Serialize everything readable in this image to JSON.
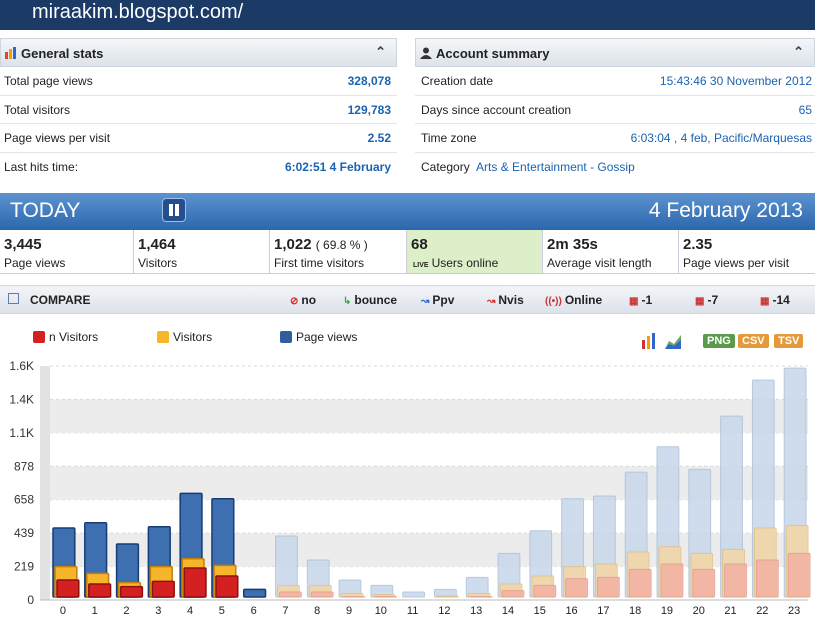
{
  "site": {
    "title": "miraakim.blogspot.com/"
  },
  "general_stats": {
    "title": "General stats",
    "rows": [
      {
        "label": "Total page views",
        "value": "328,078"
      },
      {
        "label": "Total visitors",
        "value": "129,783"
      },
      {
        "label": "Page views per visit",
        "value": "2.52"
      },
      {
        "label": "Last hits time:",
        "value": "6:02:51 4 February"
      }
    ]
  },
  "account_summary": {
    "title": "Account summary",
    "rows": [
      {
        "label": "Creation date",
        "value": "15:43:46 30 November 2012"
      },
      {
        "label": "Days since account creation",
        "value": "65"
      },
      {
        "label": "Time zone",
        "value": "6:03:04 , 4 feb, Pacific/Marquesas"
      }
    ],
    "category_label": "Category",
    "category_value": "Arts & Entertainment - Gossip"
  },
  "today": {
    "label": "TODAY",
    "date": "4 February 2013"
  },
  "metrics": [
    {
      "value": "3,445",
      "label": "Page views"
    },
    {
      "value": "1,464",
      "label": "Visitors"
    },
    {
      "value": "1,022",
      "extra": "( 69.8 % )",
      "label": "First time visitors"
    },
    {
      "value": "68",
      "label": "Users online",
      "live_badge": "LIVE"
    },
    {
      "value": "2m 35s",
      "label": "Average visit length"
    },
    {
      "value": "2.35",
      "label": "Page views per visit"
    }
  ],
  "compare": {
    "label": "COMPARE",
    "buttons": [
      "no",
      "bounce",
      "Ppv",
      "Nvis",
      "Online",
      "-1",
      "-7",
      "-14"
    ]
  },
  "export": [
    "PNG",
    "CSV",
    "TSV"
  ],
  "colors": {
    "new_visitors": "#d42020",
    "visitors": "#f7b52c",
    "page_views": "#2e5e9e",
    "topbar": "#1b3a66",
    "link": "#1a63b2"
  },
  "chart_data": {
    "type": "bar",
    "legend": [
      "n Visitors",
      "Visitors",
      "Page views"
    ],
    "categories": [
      "0",
      "1",
      "2",
      "3",
      "4",
      "5",
      "6",
      "7",
      "8",
      "9",
      "10",
      "11",
      "12",
      "13",
      "14",
      "15",
      "16",
      "17",
      "18",
      "19",
      "20",
      "21",
      "22",
      "23"
    ],
    "y_ticks": [
      "0",
      "219",
      "439",
      "658",
      "878",
      "1.1K",
      "1.4K",
      "1.6K"
    ],
    "ylim": [
      0,
      1756
    ],
    "current_hour_index": 6,
    "series": [
      {
        "name": "n Visitors",
        "values": [
          150,
          120,
          100,
          140,
          240,
          180,
          10,
          60,
          60,
          25,
          25,
          15,
          15,
          25,
          70,
          110,
          160,
          170,
          230,
          270,
          230,
          270,
          300,
          350
        ]
      },
      {
        "name": "Visitors",
        "values": [
          250,
          200,
          130,
          250,
          310,
          260,
          20,
          110,
          110,
          50,
          40,
          20,
          30,
          50,
          120,
          180,
          250,
          270,
          360,
          400,
          350,
          380,
          540,
          560
        ]
      },
      {
        "name": "Page views",
        "values": [
          540,
          580,
          420,
          550,
          800,
          760,
          80,
          480,
          300,
          150,
          110,
          60,
          80,
          170,
          350,
          520,
          760,
          780,
          960,
          1150,
          980,
          1380,
          1650,
          1740
        ]
      }
    ]
  }
}
